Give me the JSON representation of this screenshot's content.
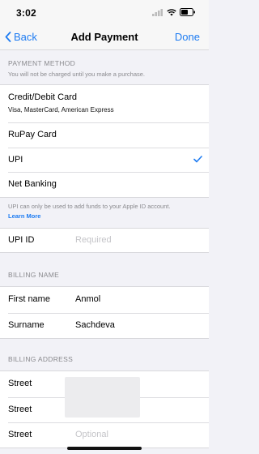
{
  "status": {
    "time": "3:02"
  },
  "nav": {
    "back_label": "Back",
    "title": "Add Payment",
    "done_label": "Done"
  },
  "payment_method": {
    "header": "PAYMENT METHOD",
    "subheader": "You will not be charged until you make a purchase.",
    "options": [
      {
        "label": "Credit/Debit Card",
        "sublabel": "Visa, MasterCard, American Express",
        "selected": false
      },
      {
        "label": "RuPay Card",
        "selected": false
      },
      {
        "label": "UPI",
        "selected": true
      },
      {
        "label": "Net Banking",
        "selected": false
      }
    ],
    "footer_note": "UPI can only be used to add funds to your Apple ID account.",
    "learn_more": "Learn More"
  },
  "upi": {
    "label": "UPI ID",
    "placeholder": "Required"
  },
  "billing_name": {
    "header": "BILLING NAME",
    "first_name_label": "First name",
    "first_name_value": "Anmol",
    "surname_label": "Surname",
    "surname_value": "Sachdeva"
  },
  "billing_address": {
    "header": "BILLING ADDRESS",
    "street1_label": "Street",
    "street2_label": "Street",
    "street3_label": "Street",
    "street3_placeholder": "Optional"
  },
  "colors": {
    "accent": "#1e7cf2",
    "background": "#f2f2f7",
    "secondary_text": "#8a8a8e"
  }
}
